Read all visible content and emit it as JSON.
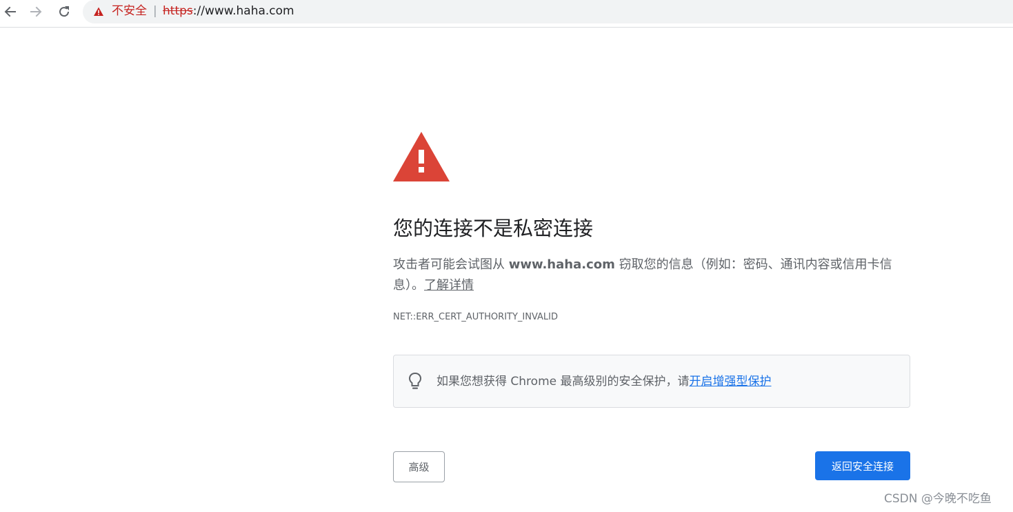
{
  "browser": {
    "security_status": "不安全",
    "separator": "|",
    "url_scheme": "https",
    "url_rest": "://www.haha.com"
  },
  "interstitial": {
    "heading": "您的连接不是私密连接",
    "explanation_prefix": "攻击者可能会试图从 ",
    "explanation_domain": "www.haha.com",
    "explanation_suffix": " 窃取您的信息（例如：密码、通讯内容或信用卡信息）。",
    "learn_more_link": "了解详情",
    "error_code": "NET::ERR_CERT_AUTHORITY_INVALID",
    "tip_text": "如果您想获得 Chrome 最高级别的安全保护，请",
    "tip_link": "开启增强型保护",
    "advanced_button": "高级",
    "back_button": "返回安全连接"
  },
  "watermark": "CSDN @今晚不吃鱼",
  "colors": {
    "danger": "#c5221f",
    "warning_icon": "#db4437",
    "primary_button": "#1a73e8",
    "link": "#1a73e8"
  },
  "icons": {
    "back": "back-arrow-icon",
    "forward": "forward-arrow-icon",
    "reload": "reload-icon",
    "security": "warning-triangle-icon",
    "page_warning": "warning-triangle-icon",
    "tip": "lightbulb-icon"
  }
}
